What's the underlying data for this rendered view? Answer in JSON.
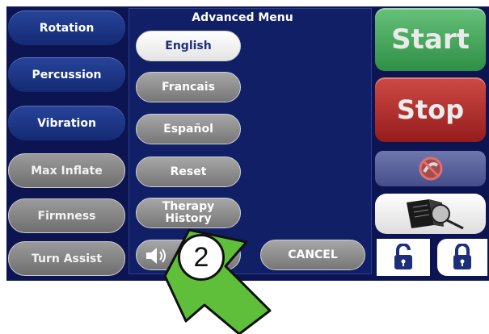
{
  "left_menu": {
    "rotation": "Rotation",
    "percussion": "Percussion",
    "vibration": "Vibration",
    "max_inflate": "Max Inflate",
    "firmness": "Firmness",
    "turn_assist": "Turn Assist"
  },
  "advanced_menu": {
    "title": "Advanced Menu",
    "english": "English",
    "francais": "Francais",
    "espanol": "Español",
    "reset": "Reset",
    "therapy_history_line1": "Therapy",
    "therapy_history_line2": "History",
    "cancel": "CANCEL",
    "selected_language": "English"
  },
  "right_panel": {
    "start": "Start",
    "stop": "Stop"
  },
  "callout": {
    "step_number": "2"
  },
  "colors": {
    "background": "#0c1552",
    "start_green": "#2e8f45",
    "stop_red": "#951c1c",
    "arrow_green": "#5fbf3a"
  },
  "icons": [
    "speaker-icon",
    "no-symbol-icon",
    "manual-magnifier-icon",
    "unlock-icon",
    "lock-icon"
  ]
}
